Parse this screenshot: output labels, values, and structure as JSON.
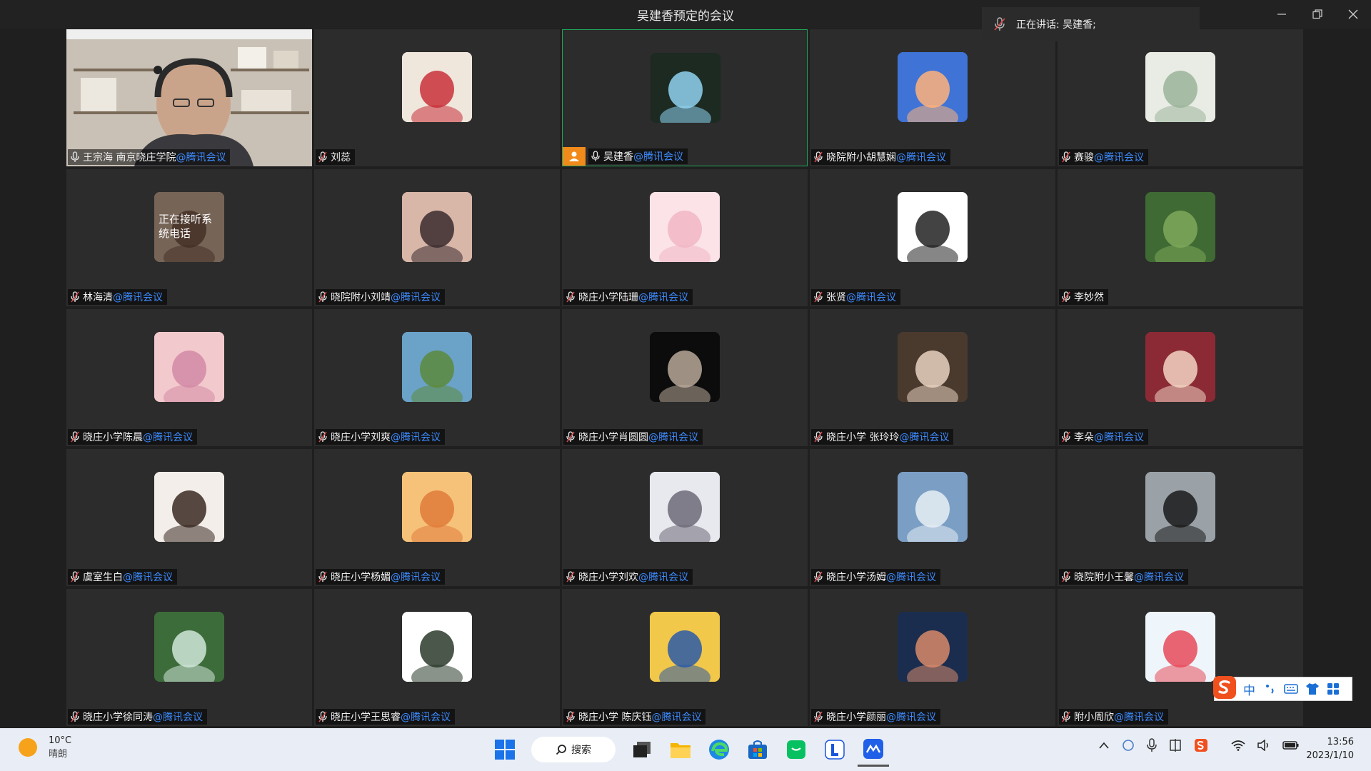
{
  "window": {
    "title": "吴建香预定的会议"
  },
  "speaking": {
    "label": "正在讲话: 吴建香;"
  },
  "participants": [
    {
      "name": "王宗海 南京晓庄学院",
      "org": "@腾讯会议"
    },
    {
      "name": "刘蕊",
      "org": ""
    },
    {
      "name": "吴建香",
      "org": "@腾讯会议"
    },
    {
      "name": "晓院附小胡慧娴",
      "org": "@腾讯会议"
    },
    {
      "name": "赛骏",
      "org": "@腾讯会议"
    },
    {
      "name": "林海清",
      "org": "@腾讯会议",
      "overlay": "正在接听系统电话"
    },
    {
      "name": "晓院附小刘靖",
      "org": "@腾讯会议"
    },
    {
      "name": "晓庄小学陆珊",
      "org": "@腾讯会议"
    },
    {
      "name": "张贤",
      "org": "@腾讯会议"
    },
    {
      "name": "李妙然",
      "org": ""
    },
    {
      "name": "晓庄小学陈晨",
      "org": "@腾讯会议"
    },
    {
      "name": "晓庄小学刘爽",
      "org": "@腾讯会议"
    },
    {
      "name": "晓庄小学肖圆圆",
      "org": "@腾讯会议"
    },
    {
      "name": "晓庄小学 张玲玲",
      "org": "@腾讯会议"
    },
    {
      "name": "李朵",
      "org": "@腾讯会议"
    },
    {
      "name": "虞室生白",
      "org": "@腾讯会议"
    },
    {
      "name": "晓庄小学杨媚",
      "org": "@腾讯会议"
    },
    {
      "name": "晓庄小学刘欢",
      "org": "@腾讯会议"
    },
    {
      "name": "晓庄小学汤姆",
      "org": "@腾讯会议"
    },
    {
      "name": "晓院附小王馨",
      "org": "@腾讯会议"
    },
    {
      "name": "晓庄小学徐同涛",
      "org": "@腾讯会议"
    },
    {
      "name": "晓庄小学王思睿",
      "org": "@腾讯会议"
    },
    {
      "name": "晓庄小学 陈庆钰",
      "org": "@腾讯会议"
    },
    {
      "name": "晓庄小学颜丽",
      "org": "@腾讯会议"
    },
    {
      "name": "附小周欣",
      "org": "@腾讯会议"
    }
  ],
  "ime": {
    "lang": "中"
  },
  "taskbar": {
    "temp": "10°C",
    "weather": "晴朗",
    "search": "搜索",
    "time": "13:56",
    "date": "2023/1/10"
  }
}
